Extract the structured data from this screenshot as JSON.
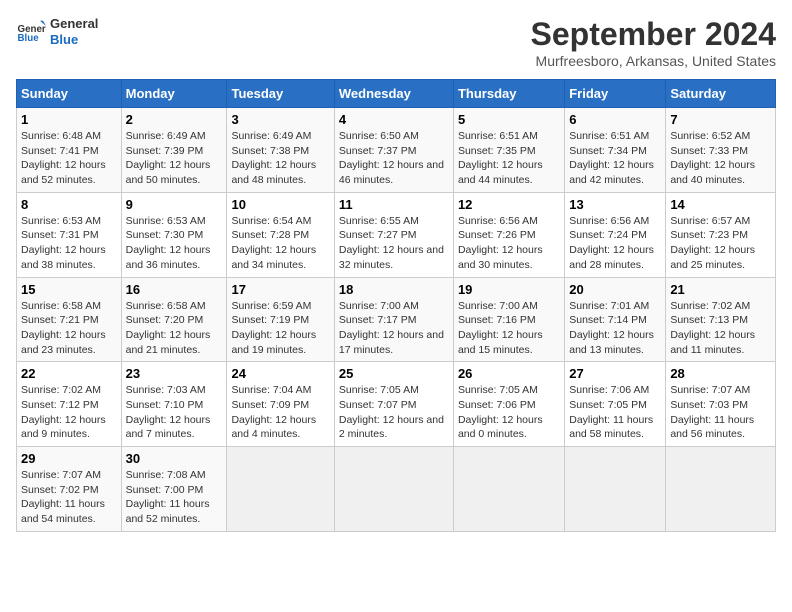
{
  "logo": {
    "general": "General",
    "blue": "Blue"
  },
  "title": "September 2024",
  "subtitle": "Murfreesboro, Arkansas, United States",
  "days_of_week": [
    "Sunday",
    "Monday",
    "Tuesday",
    "Wednesday",
    "Thursday",
    "Friday",
    "Saturday"
  ],
  "weeks": [
    [
      {
        "num": "1",
        "sunrise": "6:48 AM",
        "sunset": "7:41 PM",
        "daylight": "12 hours and 52 minutes."
      },
      {
        "num": "2",
        "sunrise": "6:49 AM",
        "sunset": "7:39 PM",
        "daylight": "12 hours and 50 minutes."
      },
      {
        "num": "3",
        "sunrise": "6:49 AM",
        "sunset": "7:38 PM",
        "daylight": "12 hours and 48 minutes."
      },
      {
        "num": "4",
        "sunrise": "6:50 AM",
        "sunset": "7:37 PM",
        "daylight": "12 hours and 46 minutes."
      },
      {
        "num": "5",
        "sunrise": "6:51 AM",
        "sunset": "7:35 PM",
        "daylight": "12 hours and 44 minutes."
      },
      {
        "num": "6",
        "sunrise": "6:51 AM",
        "sunset": "7:34 PM",
        "daylight": "12 hours and 42 minutes."
      },
      {
        "num": "7",
        "sunrise": "6:52 AM",
        "sunset": "7:33 PM",
        "daylight": "12 hours and 40 minutes."
      }
    ],
    [
      {
        "num": "8",
        "sunrise": "6:53 AM",
        "sunset": "7:31 PM",
        "daylight": "12 hours and 38 minutes."
      },
      {
        "num": "9",
        "sunrise": "6:53 AM",
        "sunset": "7:30 PM",
        "daylight": "12 hours and 36 minutes."
      },
      {
        "num": "10",
        "sunrise": "6:54 AM",
        "sunset": "7:28 PM",
        "daylight": "12 hours and 34 minutes."
      },
      {
        "num": "11",
        "sunrise": "6:55 AM",
        "sunset": "7:27 PM",
        "daylight": "12 hours and 32 minutes."
      },
      {
        "num": "12",
        "sunrise": "6:56 AM",
        "sunset": "7:26 PM",
        "daylight": "12 hours and 30 minutes."
      },
      {
        "num": "13",
        "sunrise": "6:56 AM",
        "sunset": "7:24 PM",
        "daylight": "12 hours and 28 minutes."
      },
      {
        "num": "14",
        "sunrise": "6:57 AM",
        "sunset": "7:23 PM",
        "daylight": "12 hours and 25 minutes."
      }
    ],
    [
      {
        "num": "15",
        "sunrise": "6:58 AM",
        "sunset": "7:21 PM",
        "daylight": "12 hours and 23 minutes."
      },
      {
        "num": "16",
        "sunrise": "6:58 AM",
        "sunset": "7:20 PM",
        "daylight": "12 hours and 21 minutes."
      },
      {
        "num": "17",
        "sunrise": "6:59 AM",
        "sunset": "7:19 PM",
        "daylight": "12 hours and 19 minutes."
      },
      {
        "num": "18",
        "sunrise": "7:00 AM",
        "sunset": "7:17 PM",
        "daylight": "12 hours and 17 minutes."
      },
      {
        "num": "19",
        "sunrise": "7:00 AM",
        "sunset": "7:16 PM",
        "daylight": "12 hours and 15 minutes."
      },
      {
        "num": "20",
        "sunrise": "7:01 AM",
        "sunset": "7:14 PM",
        "daylight": "12 hours and 13 minutes."
      },
      {
        "num": "21",
        "sunrise": "7:02 AM",
        "sunset": "7:13 PM",
        "daylight": "12 hours and 11 minutes."
      }
    ],
    [
      {
        "num": "22",
        "sunrise": "7:02 AM",
        "sunset": "7:12 PM",
        "daylight": "12 hours and 9 minutes."
      },
      {
        "num": "23",
        "sunrise": "7:03 AM",
        "sunset": "7:10 PM",
        "daylight": "12 hours and 7 minutes."
      },
      {
        "num": "24",
        "sunrise": "7:04 AM",
        "sunset": "7:09 PM",
        "daylight": "12 hours and 4 minutes."
      },
      {
        "num": "25",
        "sunrise": "7:05 AM",
        "sunset": "7:07 PM",
        "daylight": "12 hours and 2 minutes."
      },
      {
        "num": "26",
        "sunrise": "7:05 AM",
        "sunset": "7:06 PM",
        "daylight": "12 hours and 0 minutes."
      },
      {
        "num": "27",
        "sunrise": "7:06 AM",
        "sunset": "7:05 PM",
        "daylight": "11 hours and 58 minutes."
      },
      {
        "num": "28",
        "sunrise": "7:07 AM",
        "sunset": "7:03 PM",
        "daylight": "11 hours and 56 minutes."
      }
    ],
    [
      {
        "num": "29",
        "sunrise": "7:07 AM",
        "sunset": "7:02 PM",
        "daylight": "11 hours and 54 minutes."
      },
      {
        "num": "30",
        "sunrise": "7:08 AM",
        "sunset": "7:00 PM",
        "daylight": "11 hours and 52 minutes."
      },
      null,
      null,
      null,
      null,
      null
    ]
  ]
}
